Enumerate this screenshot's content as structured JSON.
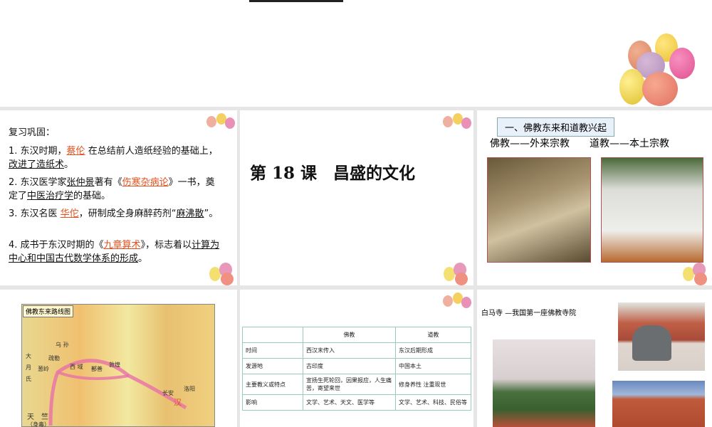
{
  "slide1": {
    "heading": "复习巩固：",
    "q1": {
      "pre": "1. 东汉时期，",
      "answer": "蔡伦",
      "post": " 在总结前人造纸经验的基础上，",
      "u": "改进了造纸术",
      "end": "。"
    },
    "q2": {
      "pre": "2. 东汉医学家",
      "u1": "张仲景",
      "mid": "著有《",
      "answer": "伤寒杂病论",
      "post": "》一书，奠定了",
      "u2": "中医治疗学",
      "end": "的基础。"
    },
    "q3": {
      "pre": "3. 东汉名医 ",
      "answer": "华佗",
      "post": "，研制成全身麻醉药剂“",
      "u": "麻沸散",
      "end": "”。"
    },
    "q4": {
      "pre": "4. 成书于东汉时期的《",
      "answer": "九章算术",
      "post": "》，标志着以",
      "u": "计算为中心和中国古代数学体系的形成",
      "end": "。"
    }
  },
  "slide2": {
    "title": "第 18 课　昌盛的文化"
  },
  "slide3": {
    "section": "一、佛教东来和道教兴起",
    "left": "佛教——外来宗教",
    "right": "道教——本土宗教"
  },
  "slide4": {
    "map_title": "佛教东来路线图",
    "labels": [
      "大",
      "月",
      "氏",
      "疏勒",
      "葱岭",
      "西 域",
      "鄯善",
      "敦煌",
      "长安",
      "洛阳",
      "汉",
      "天　竺",
      "（身毒）",
      "乌 孙"
    ]
  },
  "slide5": {
    "headers": [
      "",
      "佛教",
      "道教"
    ],
    "rows": [
      [
        "时间",
        "西汉末传入",
        "东汉后期形成"
      ],
      [
        "发源地",
        "古印度",
        "中国本土"
      ],
      [
        "主要教义或特点",
        "宣扬生死轮回，因果报应，人生痛苦，寄望来世",
        "修身养性 注重现世"
      ],
      [
        "影响",
        "文学、艺术、天文、医学等",
        "文学、艺术、科技、民俗等"
      ]
    ]
  },
  "slide6": {
    "caption": "白马寺 —我国第一座佛教寺院"
  }
}
